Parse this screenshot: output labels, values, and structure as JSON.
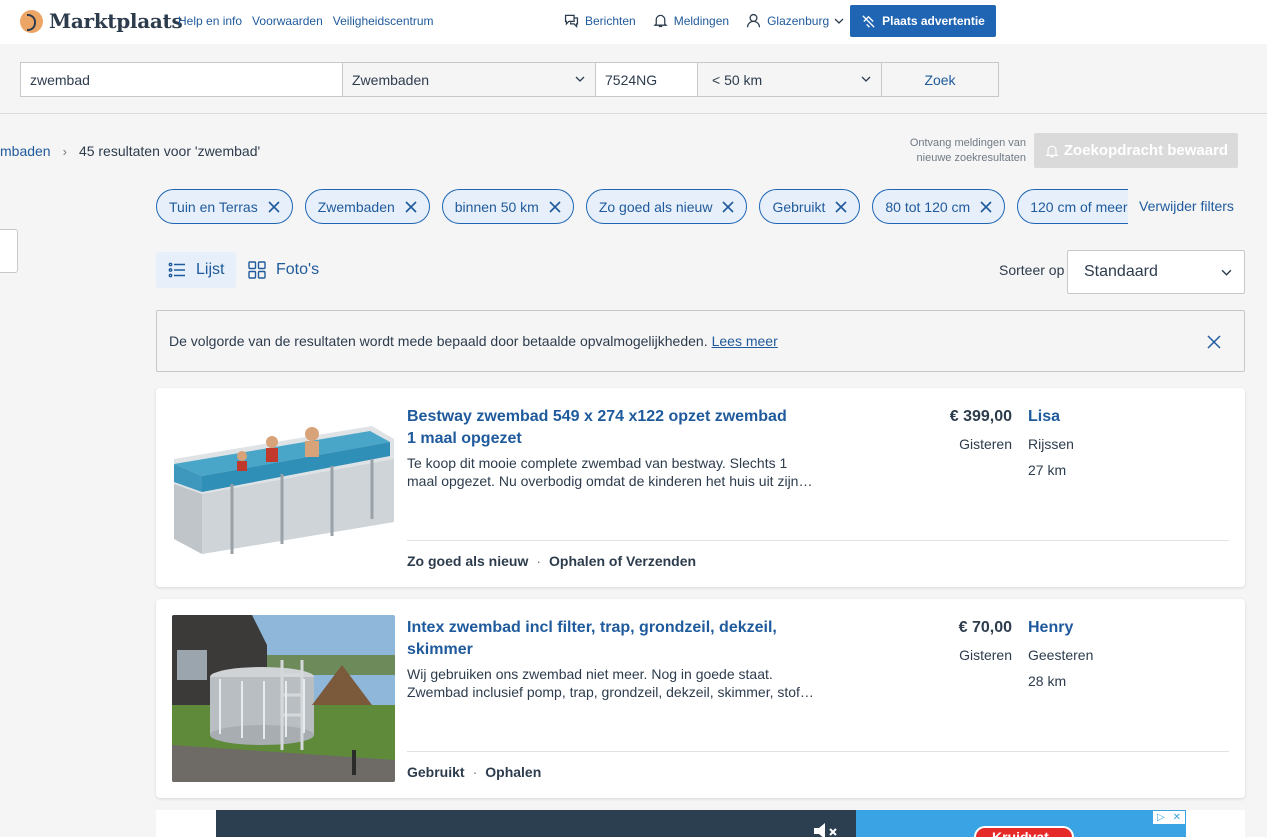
{
  "header": {
    "logo_text": "Marktplaats",
    "links": [
      "Help en info",
      "Voorwaarden",
      "Veiligheidscentrum"
    ],
    "messages": "Berichten",
    "notifications": "Meldingen",
    "user": "Glazenburg",
    "post_button": "Plaats advertentie"
  },
  "search": {
    "query": "zwembad",
    "category": "Zwembaden",
    "postcode": "7524NG",
    "distance": "< 50 km",
    "submit": "Zoek"
  },
  "breadcrumb": {
    "parent": "mbaden",
    "results": "45 resultaten voor 'zwembad'"
  },
  "saved_search": {
    "hint": "Ontvang meldingen van nieuwe zoekresultaten",
    "button": "Zoekopdracht bewaard"
  },
  "filters": {
    "chips": [
      "Tuin en Terras",
      "Zwembaden",
      "binnen 50 km",
      "Zo goed als nieuw",
      "Gebruikt",
      "80 tot 120 cm",
      "120 cm of meer"
    ],
    "remove_all": "Verwijder filters"
  },
  "view": {
    "list": "Lijst",
    "photos": "Foto's",
    "sort_label": "Sorteer op",
    "sort_value": "Standaard"
  },
  "notice": {
    "text": "De volgorde van de resultaten wordt mede bepaald door betaalde opvalmogelijkheden.",
    "link": "Lees meer"
  },
  "listings": [
    {
      "title": "Bestway zwembad 549 x 274 x122 opzet zwembad 1 maal opgezet",
      "description": "Te koop dit mooie complete zwembad van bestway. Slechts 1 maal opgezet. Nu overbodig omdat de kinderen het huis uit zijn…",
      "price": "€ 399,00",
      "date": "Gisteren",
      "seller": "Lisa",
      "city": "Rijssen",
      "distance": "27 km",
      "condition": "Zo goed als nieuw",
      "delivery": "Ophalen of Verzenden"
    },
    {
      "title": "Intex zwembad incl filter, trap, grondzeil, dekzeil, skimmer",
      "description": "Wij gebruiken ons zwembad niet meer. Nog in goede staat. Zwembad inclusief pomp, trap, grondzeil, dekzeil, skimmer, stof…",
      "price": "€ 70,00",
      "date": "Gisteren",
      "seller": "Henry",
      "city": "Geesteren",
      "distance": "28 km",
      "condition": "Gebruikt",
      "delivery": "Ophalen"
    }
  ],
  "ad": {
    "badge": "Kruidvat"
  },
  "colors": {
    "brand_blue": "#1f65b4",
    "link_blue": "#1f5a9c",
    "logo_orange": "#eda566"
  }
}
